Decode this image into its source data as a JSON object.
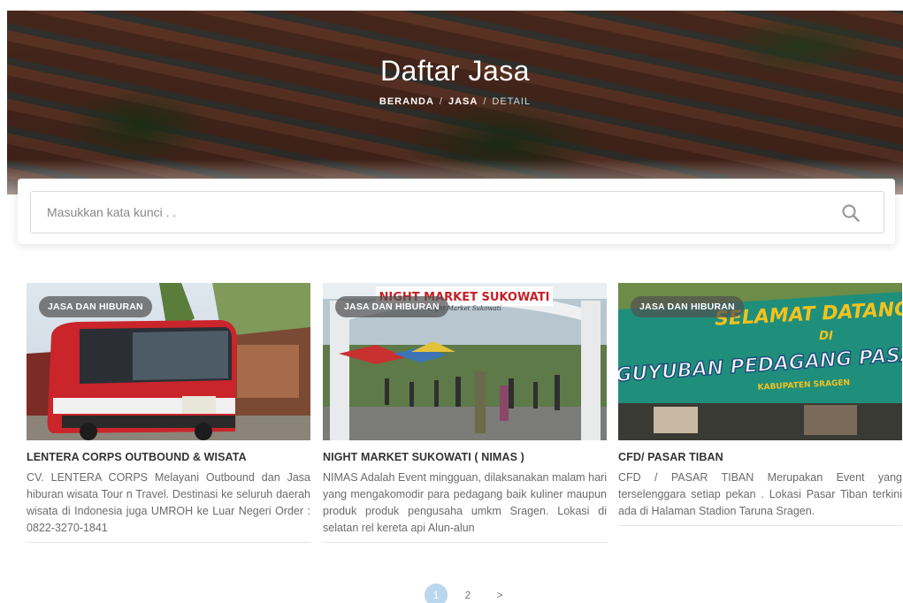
{
  "hero": {
    "title": "Daftar Jasa",
    "breadcrumb": {
      "home": "BERANDA",
      "section": "JASA",
      "current": "DETAIL"
    }
  },
  "search": {
    "placeholder": "Masukkan kata kunci . .",
    "value": ""
  },
  "cards": [
    {
      "category": "JASA DAN HIBURAN",
      "title": "LENTERA CORPS OUTBOUND & WISATA",
      "description": "CV. LENTERA CORPS Melayani Outbound dan Jasa hiburan wisata Tour n Travel. Destinasi ke seluruh daerah wisata di Indonesia juga UMROH ke Luar Negeri Order : 0822-3270-1841"
    },
    {
      "category": "JASA DAN HIBURAN",
      "title": "NIGHT MARKET SUKOWATI ( NIMAS )",
      "description": "NIMAS Adalah Event mingguan, dilaksanakan malam hari yang mengakomodir para pedagang baik kuliner maupun produk produk pengusaha umkm Sragen. Lokasi di selatan rel kereta api Alun-alun",
      "image_text": {
        "banner": "NIGHT MARKET SUKOWATI",
        "sub": "Night Market Sukowati"
      }
    },
    {
      "category": "JASA DAN HIBURAN",
      "title": "CFD/ PASAR TIBAN",
      "description": "CFD / PASAR TIBAN Merupakan Event yang terselenggara setiap pekan . Lokasi Pasar Tiban terkini ada di Halaman Stadion Taruna Sragen.",
      "image_text": {
        "line1": "SELAMAT DATANG",
        "line2": "DI",
        "line3": "PAGUYUBAN PEDAGANG PASAR",
        "line4": "KABUPATEN SRAGEN"
      }
    }
  ],
  "pagination": {
    "pages": [
      "1",
      "2"
    ],
    "active": "1",
    "next": ">"
  },
  "colors": {
    "accent": "#b9d7ee",
    "badge_bg": "#505050",
    "title_text": "#333333",
    "body_text": "#6b6b6b"
  }
}
